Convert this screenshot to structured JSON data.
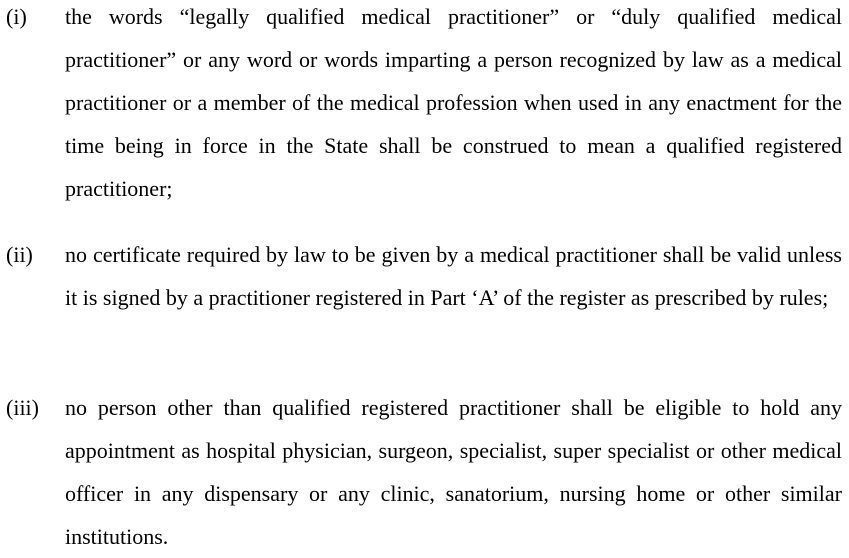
{
  "clauses": [
    {
      "number": "(i)",
      "text": "the words “legally qualified medical practitioner” or “duly qualified medical practitioner” or any word or words imparting a person recognized by law as a medical practitioner or a member of the medical profession when used in any enactment for the time being in force in the State shall be construed to mean a qualified registered practitioner;"
    },
    {
      "number": "(ii)",
      "text": "no certificate required by law to be given by a medical practitioner shall be valid unless it is signed by a practitioner registered in Part ‘A’ of the register as prescribed by rules;"
    },
    {
      "number": "(iii)",
      "text": "no person other than qualified registered practitioner shall be eligible to hold any appointment as hospital physician, surgeon, specialist, super specialist or other medical officer in any dispensary or any clinic, sanatorium, nursing home or other similar institutions."
    }
  ]
}
